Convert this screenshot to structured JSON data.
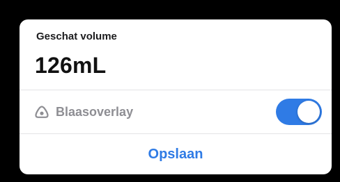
{
  "card": {
    "caption": "Geschat volume",
    "volume_value": "126mL"
  },
  "overlay": {
    "icon": "bladder-icon",
    "label": "Blaasoverlay",
    "toggle_on": true
  },
  "actions": {
    "save_label": "Opslaan"
  },
  "colors": {
    "accent": "#2f7be5",
    "background": "#000000",
    "card": "#ffffff",
    "muted_text": "#8e8e93"
  }
}
